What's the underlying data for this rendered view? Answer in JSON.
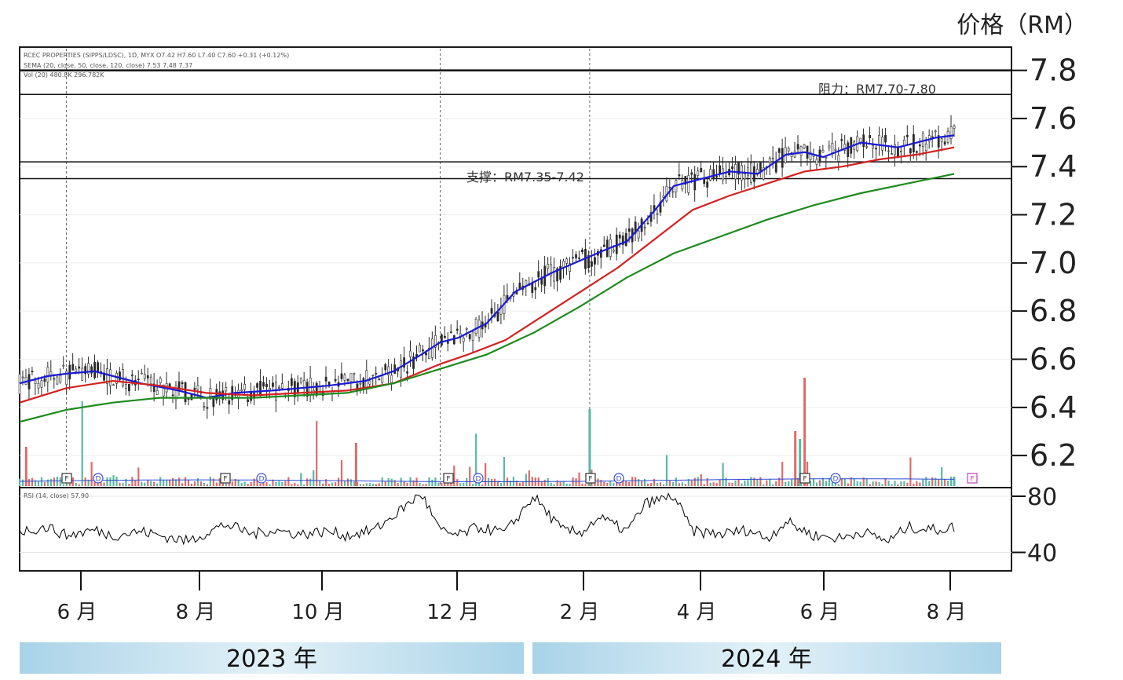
{
  "chart_data": {
    "type": "candlestick",
    "unit_label": "价格（RM）",
    "y_axis": {
      "ticks": [
        6.2,
        6.4,
        6.6,
        6.8,
        7.0,
        7.2,
        7.4,
        7.6,
        7.8
      ],
      "ylim": [
        6.07,
        7.89
      ]
    },
    "x_axis": {
      "ticks": [
        "6 月",
        "8 月",
        "10 月",
        "12 月",
        "2 月",
        "4 月",
        "6 月",
        "8 月"
      ],
      "years": [
        "2023 年",
        "2024 年"
      ]
    },
    "info_lines": [
      "RCEC PROPERTIES (SIPPS/LDSC), 1D, MYX  O7.42  H7.60  L7.40  C7.60  +0.31 (+0.12%)",
      "SEMA (20, close, 50, close, 120, close)  7.53  7.48  7.37",
      "Vol (20)  480.8K  296.782K"
    ],
    "resistance": {
      "label": "阻力：RM7.70-7.80",
      "low": 7.7,
      "high": 7.8
    },
    "support": {
      "label": "支撑：RM7.35-7.42",
      "low": 7.35,
      "high": 7.42
    },
    "series": [
      {
        "name": "EMA 20",
        "color": "#1a1ad6",
        "x": [
          0,
          0.03,
          0.05,
          0.08,
          0.1,
          0.13,
          0.17,
          0.2,
          0.23,
          0.27,
          0.3,
          0.33,
          0.37,
          0.4,
          0.43,
          0.45,
          0.47,
          0.5,
          0.53,
          0.55,
          0.57,
          0.6,
          0.63,
          0.65,
          0.68,
          0.7,
          0.73,
          0.76,
          0.79,
          0.82,
          0.84,
          0.86,
          0.9,
          0.94,
          0.98,
          1.0
        ],
        "values": [
          6.5,
          6.53,
          6.54,
          6.55,
          6.53,
          6.5,
          6.47,
          6.44,
          6.46,
          6.47,
          6.48,
          6.49,
          6.51,
          6.55,
          6.62,
          6.67,
          6.69,
          6.75,
          6.88,
          6.92,
          6.96,
          7.01,
          7.06,
          7.09,
          7.22,
          7.32,
          7.35,
          7.38,
          7.37,
          7.45,
          7.46,
          7.44,
          7.5,
          7.48,
          7.52,
          7.53
        ]
      },
      {
        "name": "EMA 50",
        "color": "#d42020",
        "x": [
          0,
          0.05,
          0.1,
          0.15,
          0.2,
          0.25,
          0.3,
          0.35,
          0.4,
          0.45,
          0.48,
          0.52,
          0.56,
          0.6,
          0.64,
          0.68,
          0.72,
          0.76,
          0.8,
          0.84,
          0.88,
          0.92,
          0.96,
          1.0
        ],
        "values": [
          6.42,
          6.48,
          6.51,
          6.49,
          6.46,
          6.45,
          6.46,
          6.47,
          6.5,
          6.58,
          6.62,
          6.68,
          6.78,
          6.88,
          6.98,
          7.1,
          7.22,
          7.28,
          7.33,
          7.38,
          7.4,
          7.43,
          7.45,
          7.48
        ]
      },
      {
        "name": "EMA 120",
        "color": "#1e8a1e",
        "x": [
          0,
          0.05,
          0.1,
          0.15,
          0.2,
          0.25,
          0.3,
          0.35,
          0.4,
          0.45,
          0.5,
          0.55,
          0.6,
          0.65,
          0.7,
          0.75,
          0.8,
          0.85,
          0.9,
          0.95,
          1.0
        ],
        "values": [
          6.34,
          6.39,
          6.42,
          6.44,
          6.44,
          6.44,
          6.45,
          6.46,
          6.5,
          6.56,
          6.62,
          6.71,
          6.82,
          6.94,
          7.04,
          7.11,
          7.18,
          7.24,
          7.29,
          7.33,
          7.37
        ]
      }
    ],
    "colors": {
      "up": "#5ab8a4",
      "down": "#e06a6a",
      "candle": "#2b2b2b",
      "rsi_line": "#000000"
    },
    "events": [
      "F",
      "D",
      "F",
      "D",
      "F",
      "D",
      "F",
      "D",
      "F",
      "D",
      "F"
    ],
    "rsi": {
      "label": "RSI (14, close)  57.90",
      "ticks": [
        40,
        80
      ],
      "range": [
        28,
        85
      ],
      "x": [
        0,
        0.03,
        0.05,
        0.08,
        0.1,
        0.13,
        0.15,
        0.18,
        0.2,
        0.22,
        0.25,
        0.27,
        0.3,
        0.33,
        0.35,
        0.38,
        0.4,
        0.43,
        0.45,
        0.47,
        0.49,
        0.52,
        0.55,
        0.58,
        0.6,
        0.62,
        0.65,
        0.67,
        0.7,
        0.72,
        0.75,
        0.78,
        0.8,
        0.82,
        0.85,
        0.88,
        0.9,
        0.93,
        0.95,
        0.98,
        1.0
      ],
      "values": [
        55,
        58,
        52,
        56,
        52,
        55,
        52,
        48,
        54,
        60,
        53,
        56,
        53,
        55,
        52,
        56,
        66,
        82,
        55,
        52,
        58,
        54,
        80,
        56,
        54,
        65,
        55,
        75,
        80,
        55,
        53,
        56,
        50,
        62,
        52,
        50,
        55,
        48,
        58,
        56,
        58
      ]
    }
  }
}
